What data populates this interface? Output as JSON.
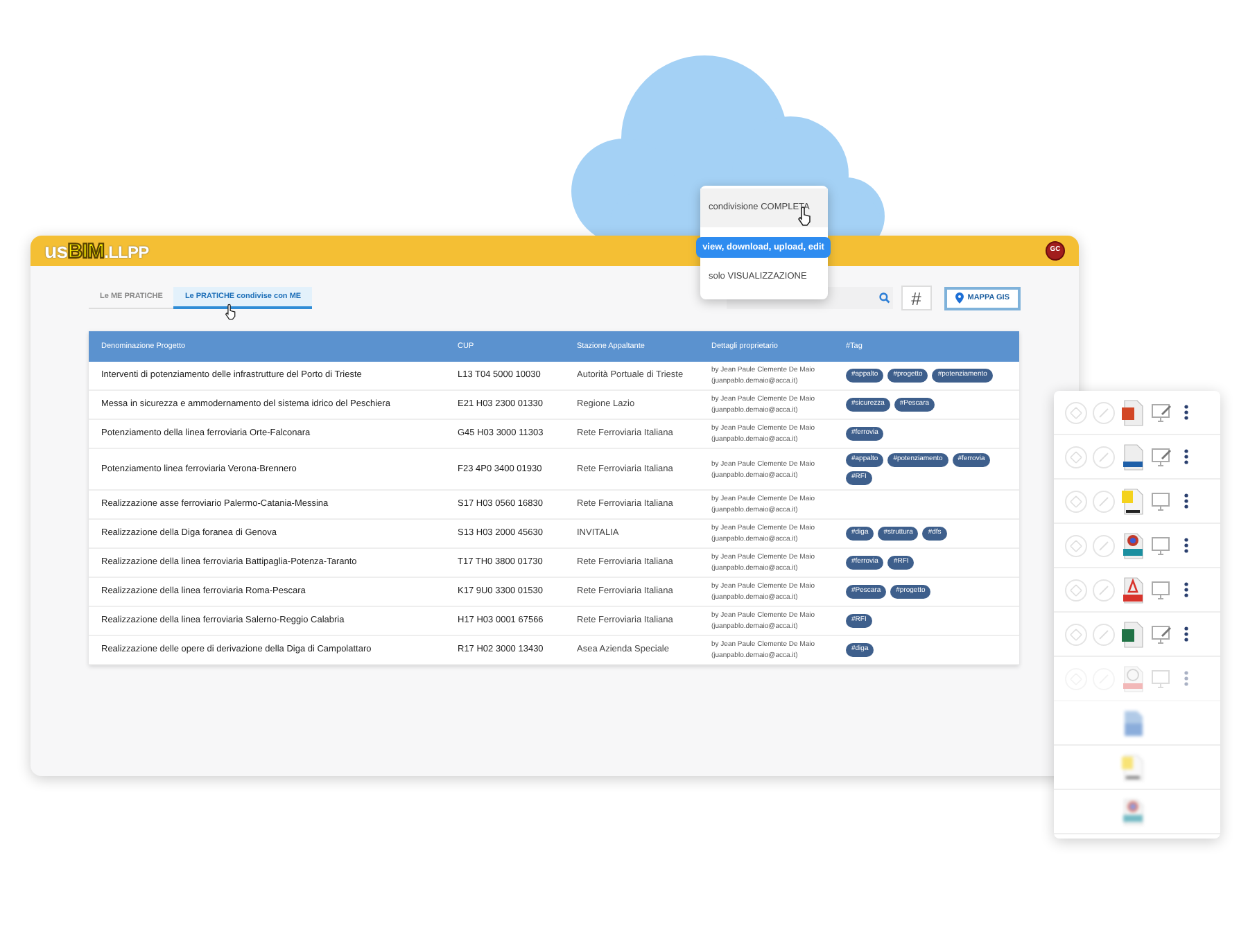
{
  "logo": {
    "prefix": "us",
    "brand": "BIM",
    "suffix": ".LLPP"
  },
  "avatar": {
    "initials": "GC"
  },
  "tabs": [
    {
      "label": "Le ME PRATICHE",
      "selected": false
    },
    {
      "label": "Le PRATICHE condivise con ME",
      "selected": true
    }
  ],
  "hash_button": {
    "label": "#"
  },
  "map_button": {
    "label": "MAPPA GIS"
  },
  "share_menu": {
    "items": [
      {
        "label": "condivisione COMPLETA",
        "highlighted": true
      },
      {
        "label": "solo VISUALIZZAZIONE",
        "highlighted": false
      }
    ],
    "tooltip": "view, download, upload, edit"
  },
  "table": {
    "columns": [
      "Denominazione Progetto",
      "CUP",
      "Stazione Appaltante",
      "Dettagli proprietario",
      "#Tag"
    ],
    "rows": [
      {
        "name": "Interventi di potenziamento delle infrastrutture del Porto di Trieste",
        "cup": "L13 T04 5000 10030",
        "station": "Autorità Portuale di Trieste",
        "owner": "by Jean Paule Clemente De Maio",
        "email": "(juanpablo.demaio@acca.it)",
        "tags": [
          "#appalto",
          "#progetto",
          "#potenziamento"
        ]
      },
      {
        "name": "Messa in sicurezza e ammodernamento del sistema idrico del Peschiera",
        "cup": "E21 H03 2300 01330",
        "station": "Regione Lazio",
        "owner": "by Jean Paule Clemente De Maio",
        "email": "(juanpablo.demaio@acca.it)",
        "tags": [
          "#sicurezza",
          "#Pescara"
        ]
      },
      {
        "name": "Potenziamento della linea ferroviaria Orte-Falconara",
        "cup": "G45 H03 3000 11303",
        "station": "Rete Ferroviaria Italiana",
        "owner": "by Jean Paule Clemente De Maio",
        "email": "(juanpablo.demaio@acca.it)",
        "tags": [
          "#ferrovia"
        ]
      },
      {
        "name": "Potenziamento linea ferroviaria Verona-Brennero",
        "cup": "F23 4P0 3400 01930",
        "station": "Rete Ferroviaria Italiana",
        "owner": "by Jean Paule Clemente De Maio",
        "email": "(juanpablo.demaio@acca.it)",
        "tags": [
          "#appalto",
          "#potenziamento",
          "#ferrovia",
          "#RFI"
        ]
      },
      {
        "name": "Realizzazione asse ferroviario Palermo-Catania-Messina",
        "cup": "S17 H03 0560 16830",
        "station": "Rete Ferroviaria Italiana",
        "owner": "by Jean Paule Clemente De Maio",
        "email": "(juanpablo.demaio@acca.it)"
      },
      {
        "name": "Realizzazione della Diga foranea di Genova",
        "cup": "S13 H03 2000 45630",
        "station": "INVITALIA",
        "owner": "by Jean Paule Clemente De Maio",
        "email": "(juanpablo.demaio@acca.it)",
        "tags": [
          "#diga",
          "#struttura",
          "#dfs"
        ]
      },
      {
        "name": "Realizzazione della linea ferroviaria Battipaglia-Potenza-Taranto",
        "cup": "T17 TH0 3800 01730",
        "station": "Rete Ferroviaria Italiana",
        "owner": "by Jean Paule Clemente De Maio",
        "email": "(juanpablo.demaio@acca.it)",
        "tags": [
          "#ferrovia",
          "#RFI"
        ]
      },
      {
        "name": "Realizzazione della linea ferroviaria Roma-Pescara",
        "cup": "K17 9U0 3300 01530",
        "station": "Rete Ferroviaria Italiana",
        "owner": "by Jean Paule Clemente De Maio",
        "email": "(juanpablo.demaio@acca.it)",
        "tags": [
          "#Pescara",
          "#progetto"
        ]
      },
      {
        "name": "Realizzazione della linea ferroviaria Salerno-Reggio Calabria",
        "cup": "H17 H03 0001 67566",
        "station": "Rete Ferroviaria Italiana",
        "owner": "by Jean Paule Clemente De Maio",
        "email": "(juanpablo.demaio@acca.it)",
        "tags": [
          "#RFI"
        ]
      },
      {
        "name": "Realizzazione delle opere di derivazione della Diga di Campolattaro",
        "cup": "R17 H02 3000 13430",
        "station": "Asea Azienda Speciale",
        "owner": "by Jean Paule Clemente De Maio",
        "email": "(juanpablo.demaio@acca.it)",
        "tags": [
          "#diga"
        ]
      }
    ]
  },
  "files": [
    {
      "kind": "presentation",
      "editable": true,
      "faded": false,
      "blurred": false
    },
    {
      "kind": "web",
      "editable": true,
      "faded": false,
      "blurred": false
    },
    {
      "kind": "yellow",
      "editable": false,
      "faded": false,
      "blurred": false
    },
    {
      "kind": "model",
      "editable": false,
      "faded": false,
      "blurred": false
    },
    {
      "kind": "pdf",
      "editable": false,
      "faded": false,
      "blurred": false
    },
    {
      "kind": "spreadsheet",
      "editable": true,
      "faded": false,
      "blurred": false
    },
    {
      "kind": "video",
      "editable": false,
      "faded": true,
      "blurred": false
    },
    {
      "kind": "blue",
      "faded": false,
      "blurred": true
    },
    {
      "kind": "yellow",
      "faded": false,
      "blurred": true
    },
    {
      "kind": "model",
      "faded": false,
      "blurred": true
    }
  ]
}
